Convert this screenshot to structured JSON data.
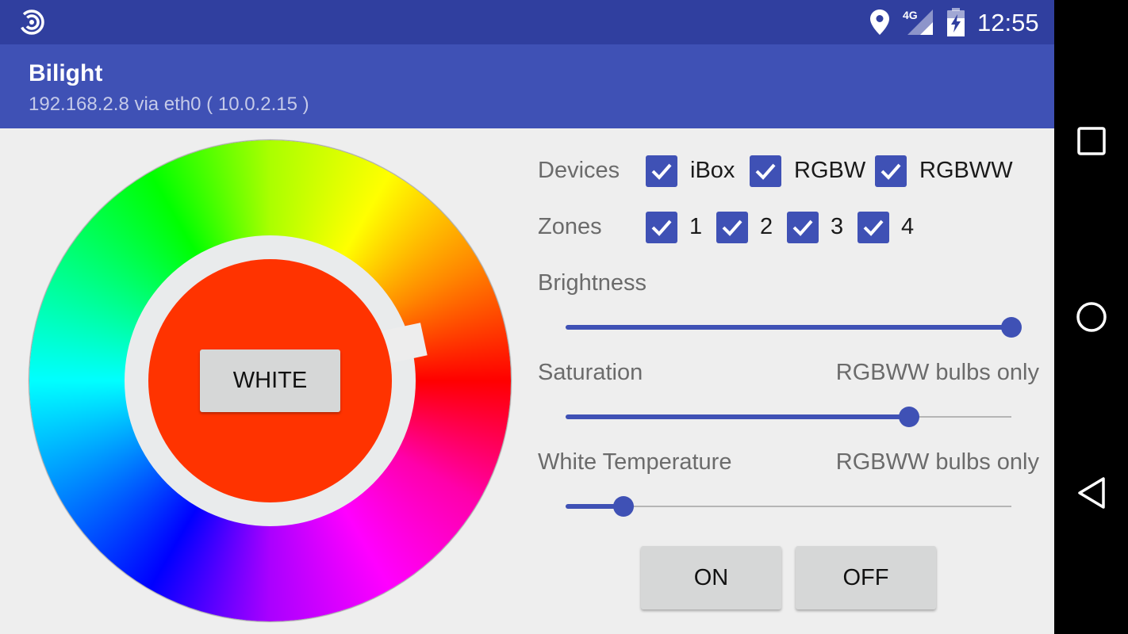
{
  "status_bar": {
    "time": "12:55",
    "network_label": "4G",
    "icons": [
      "app-notification-icon",
      "location-icon",
      "signal-icon",
      "battery-charging-icon"
    ]
  },
  "app_bar": {
    "title": "Bilight",
    "subtitle": "192.168.2.8 via eth0 ( 10.0.2.15 )"
  },
  "color_wheel": {
    "selected_color": "#ff3300",
    "white_button": "WHITE"
  },
  "devices": {
    "label": "Devices",
    "options": [
      {
        "label": "iBox",
        "checked": true
      },
      {
        "label": "RGBW",
        "checked": true
      },
      {
        "label": "RGBWW",
        "checked": true
      }
    ]
  },
  "zones": {
    "label": "Zones",
    "options": [
      {
        "label": "1",
        "checked": true
      },
      {
        "label": "2",
        "checked": true
      },
      {
        "label": "3",
        "checked": true
      },
      {
        "label": "4",
        "checked": true
      }
    ]
  },
  "brightness": {
    "label": "Brightness",
    "value": 1.0
  },
  "saturation": {
    "label": "Saturation",
    "hint": "RGBWW bulbs only",
    "value": 0.77
  },
  "white_temperature": {
    "label": "White Temperature",
    "hint": "RGBWW bulbs only",
    "value": 0.13
  },
  "buttons": {
    "on": "ON",
    "off": "OFF"
  },
  "colors": {
    "accent": "#3f51b5",
    "status_bar": "#303f9f",
    "app_bar": "#3f51b5",
    "background": "#eeeeee"
  },
  "nav_bar": {
    "icons": [
      "recents-icon",
      "home-icon",
      "back-icon"
    ]
  }
}
